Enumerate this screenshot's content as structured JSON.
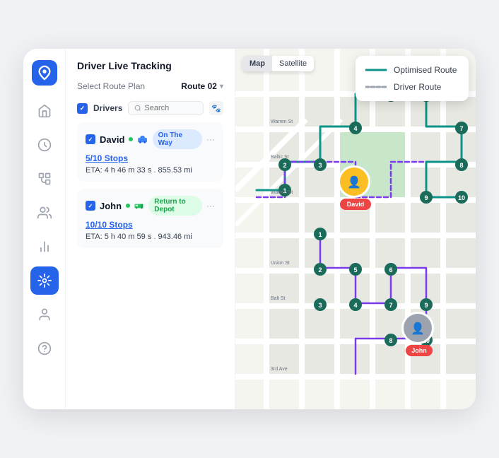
{
  "app": {
    "title": "Driver Live Tracking"
  },
  "sidebar": {
    "items": [
      {
        "id": "home",
        "icon": "home",
        "active": false
      },
      {
        "id": "location",
        "icon": "location",
        "active": false
      },
      {
        "id": "route",
        "icon": "route",
        "active": false
      },
      {
        "id": "users",
        "icon": "users",
        "active": false
      },
      {
        "id": "chart",
        "icon": "chart",
        "active": false
      },
      {
        "id": "tracking",
        "icon": "tracking",
        "active": true
      },
      {
        "id": "person",
        "icon": "person",
        "active": false
      },
      {
        "id": "help",
        "icon": "help",
        "active": false
      }
    ]
  },
  "panel": {
    "title": "Driver Live Tracking",
    "route_label": "Select Route Plan",
    "route_value": "Route 02",
    "drivers_label": "Drivers",
    "search_placeholder": "Search",
    "drivers": [
      {
        "name": "David",
        "status": "On The Way",
        "status_type": "blue",
        "stops": "5/10 Stops",
        "eta_label": "ETA:",
        "eta_value": "4 h 46 m 33 s",
        "distance": "855.53 mi",
        "dot_color": "#22c55e"
      },
      {
        "name": "John",
        "status": "Return to Depot",
        "status_type": "green",
        "stops": "10/10 Stops",
        "eta_label": "ETA:",
        "eta_value": "5 h 40 m 59 s",
        "distance": "943.46 mi",
        "dot_color": "#22c55e"
      }
    ]
  },
  "map": {
    "toggle_map": "Map",
    "toggle_satellite": "Satellite",
    "legend": {
      "items": [
        {
          "label": "Optimised Route",
          "style": "solid"
        },
        {
          "label": "Driver Route",
          "style": "dashed"
        }
      ]
    }
  }
}
